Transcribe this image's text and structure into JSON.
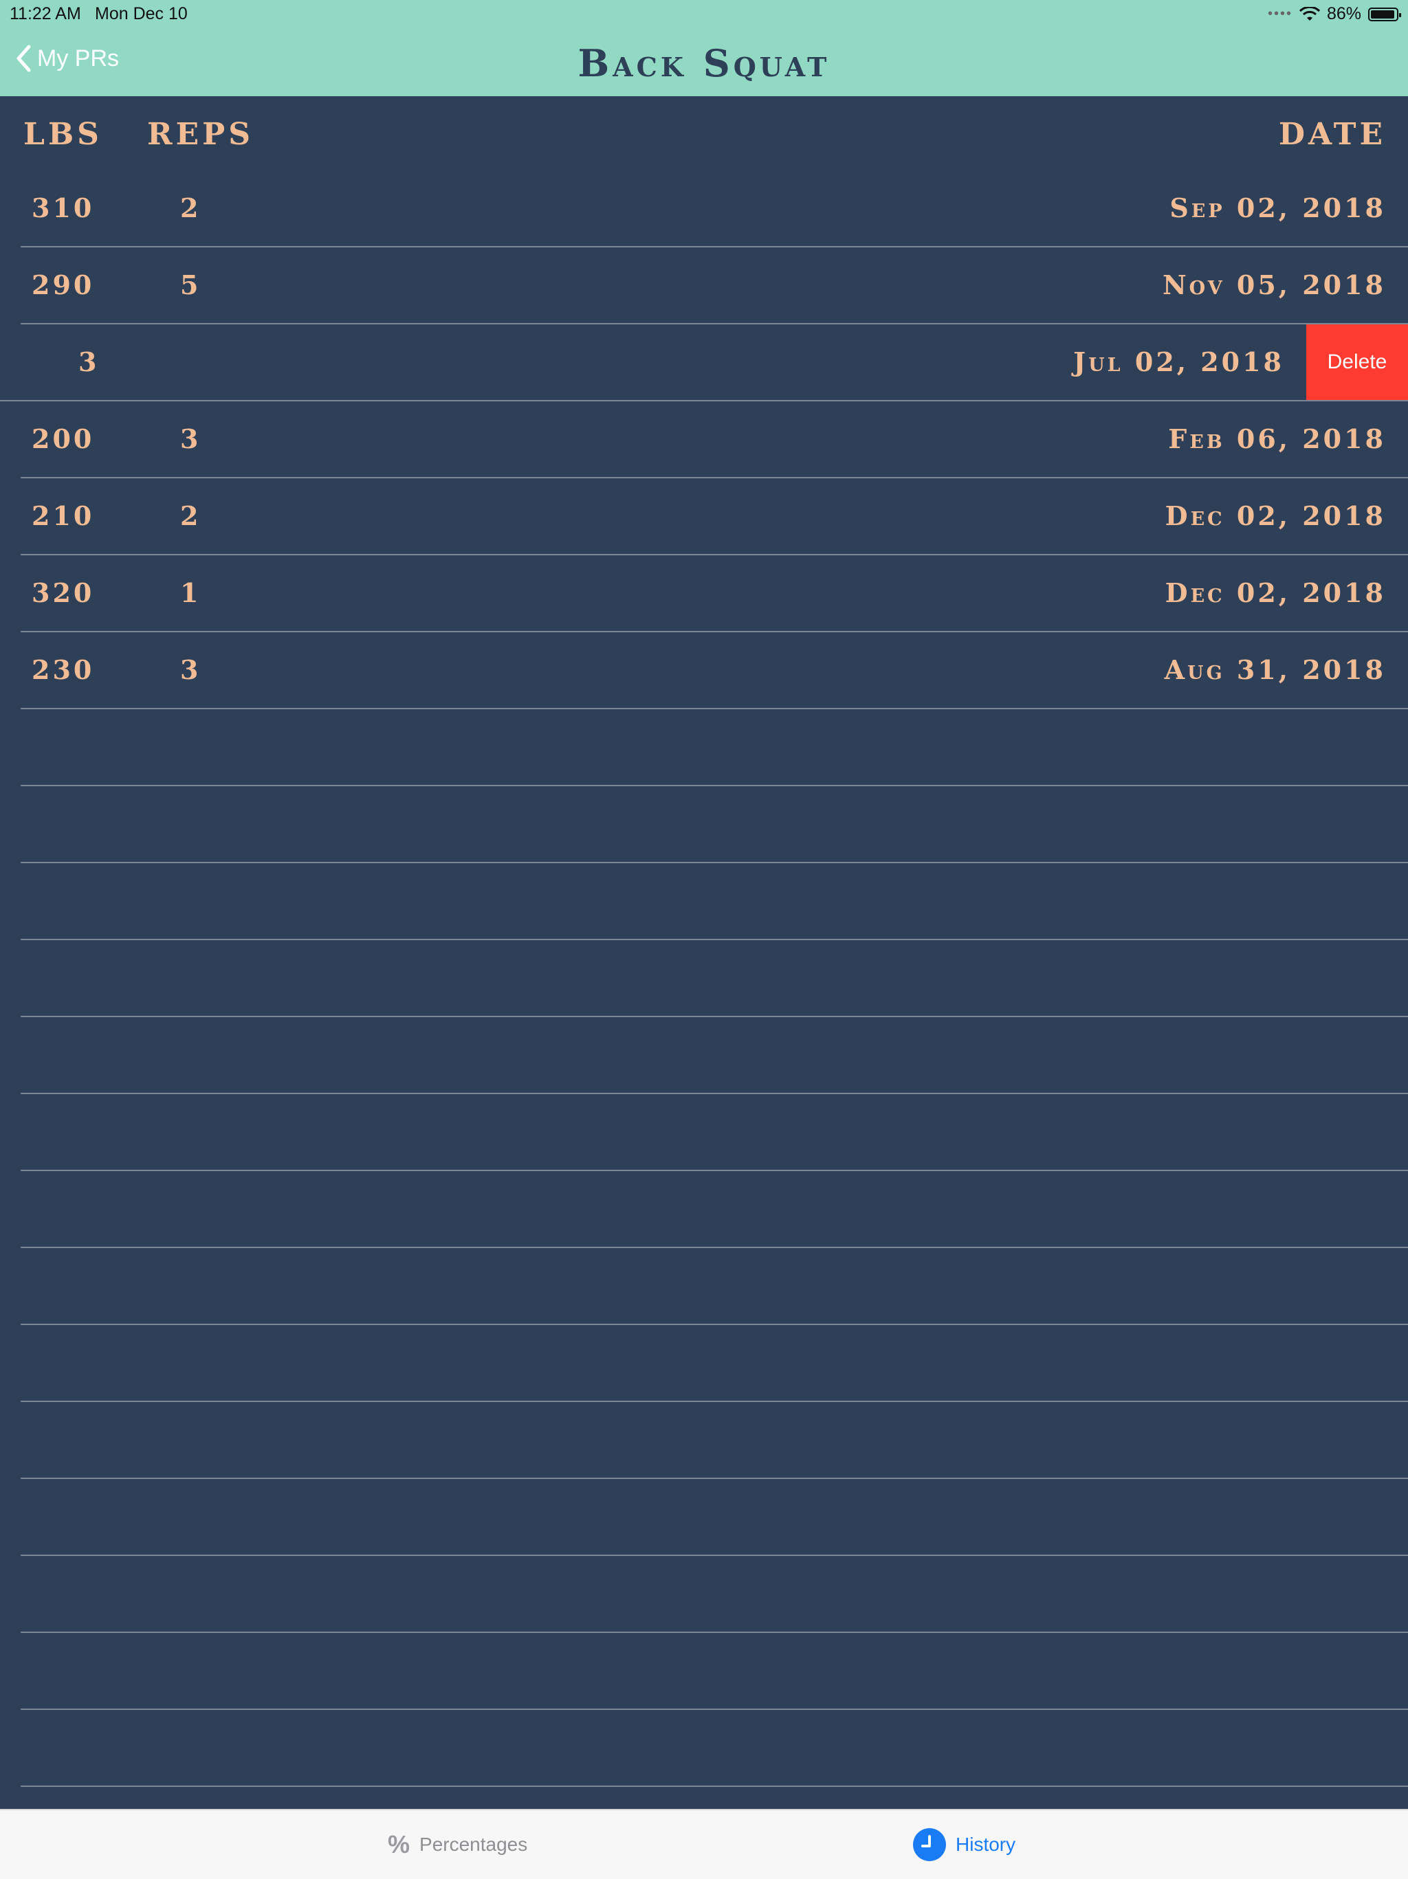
{
  "status_bar": {
    "time": "11:22 AM",
    "date": "Mon Dec 10",
    "battery": "86%"
  },
  "nav": {
    "back_label": "My PRs",
    "title": "Back Squat"
  },
  "headers": {
    "lbs": "LBS",
    "reps": "REPS",
    "date": "DATE"
  },
  "rows": [
    {
      "lbs": "310",
      "reps": "2",
      "date": "Sep 02, 2018"
    },
    {
      "lbs": "290",
      "reps": "5",
      "date": "Nov 05, 2018"
    },
    {
      "lbs": "",
      "reps": "3",
      "date": "Jul 02, 2018",
      "delete_label": "Delete"
    },
    {
      "lbs": "200",
      "reps": "3",
      "date": "Feb 06, 2018"
    },
    {
      "lbs": "210",
      "reps": "2",
      "date": "Dec 02, 2018"
    },
    {
      "lbs": "320",
      "reps": "1",
      "date": "Dec 02, 2018"
    },
    {
      "lbs": "230",
      "reps": "3",
      "date": "Aug 31, 2018"
    }
  ],
  "tab_bar": {
    "percentages": "Percentages",
    "history": "History"
  },
  "colors": {
    "nav_bg": "#92d9c3",
    "table_bg": "#2e3f58",
    "text": "#f1bb94",
    "delete": "#fd3b30",
    "tab_active": "#1a7cf5"
  }
}
